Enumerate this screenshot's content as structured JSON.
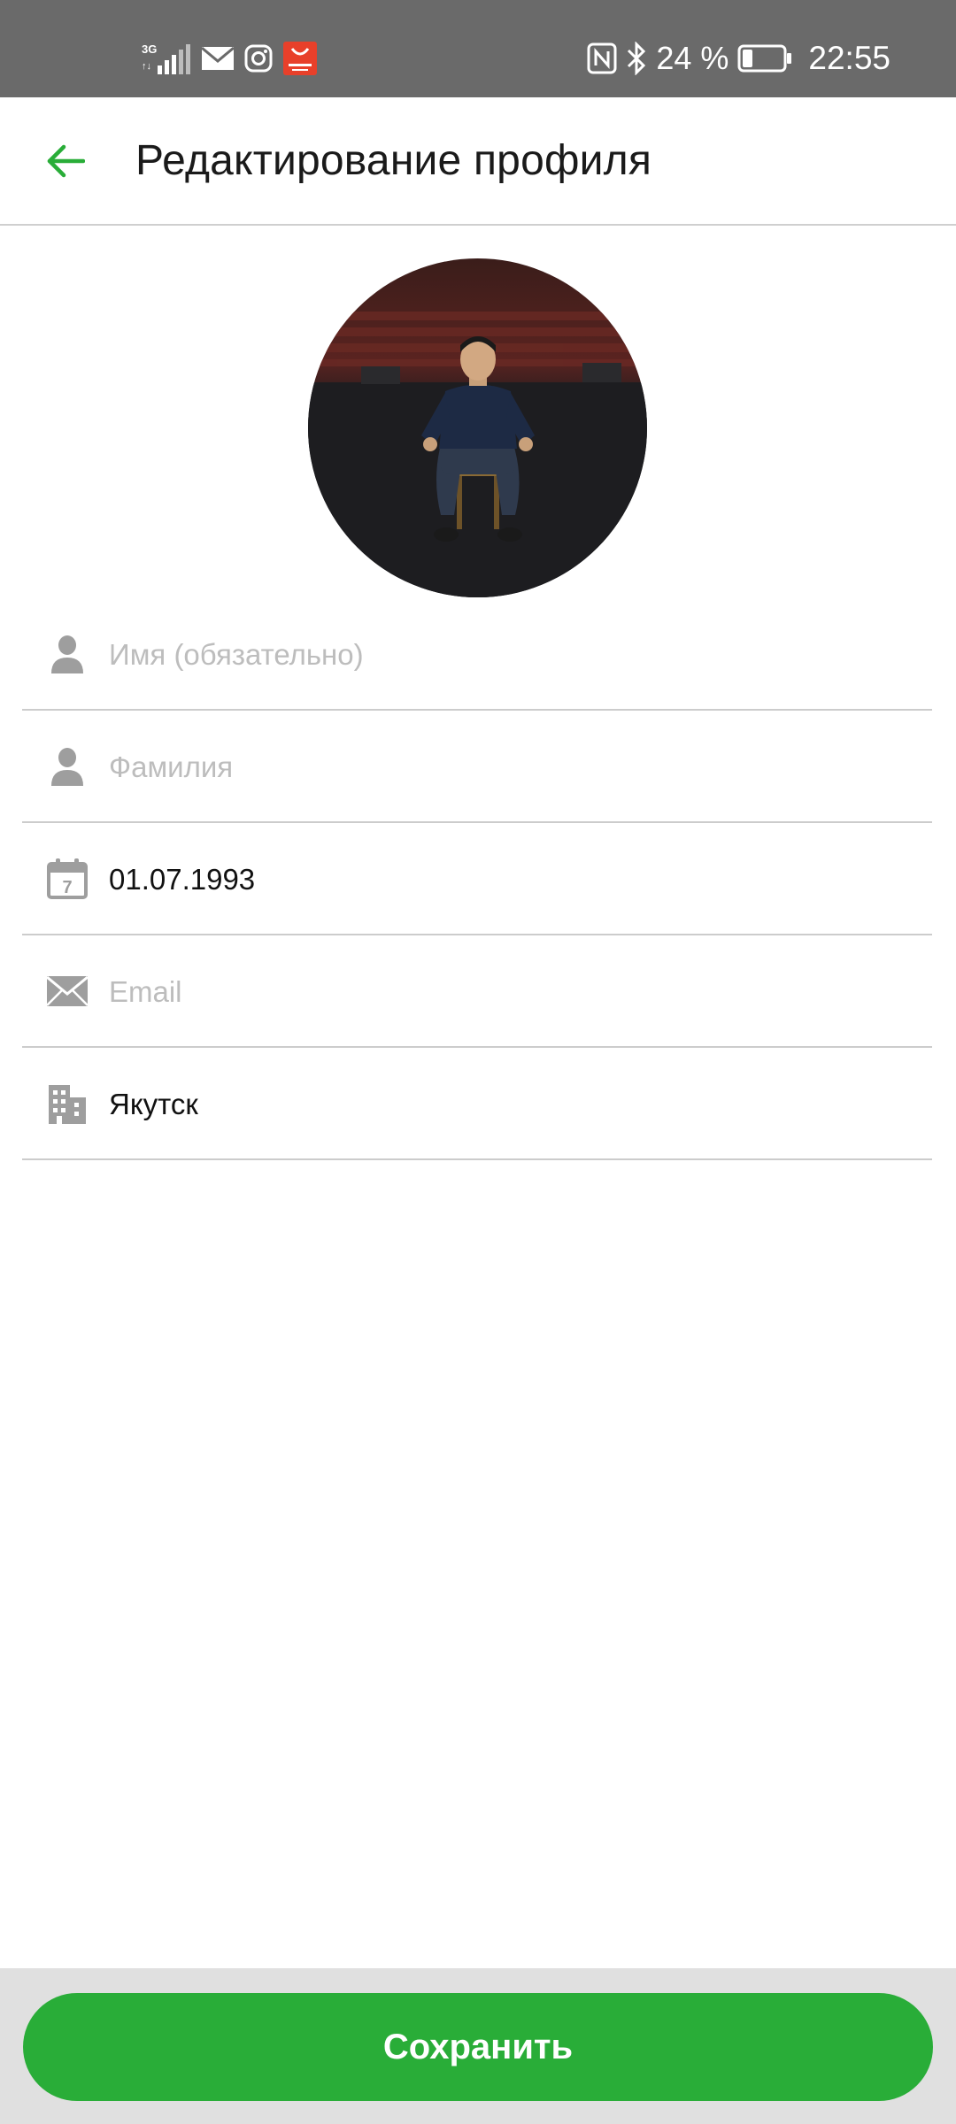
{
  "status_bar": {
    "network_label": "3G",
    "battery_percent": "24 %",
    "battery_level": 0.24,
    "time": "22:55",
    "icons": [
      "signal-icon",
      "mail-icon",
      "instagram-icon",
      "aliexpress-icon",
      "nfc-icon",
      "bluetooth-icon",
      "battery-icon"
    ]
  },
  "header": {
    "title": "Редактирование профиля",
    "back_icon": "arrow-left-icon"
  },
  "profile": {
    "avatar_icon": "profile-photo"
  },
  "form": {
    "first_name": {
      "placeholder": "Имя (обязательно)",
      "value": "",
      "icon": "person-icon"
    },
    "last_name": {
      "placeholder": "Фамилия",
      "value": "",
      "icon": "person-icon"
    },
    "birth_date": {
      "placeholder": "",
      "value": "01.07.1993",
      "icon": "calendar-icon",
      "calendar_day": "7"
    },
    "email": {
      "placeholder": "Email",
      "value": "",
      "icon": "envelope-icon"
    },
    "city": {
      "placeholder": "",
      "value": "Якутск",
      "icon": "building-icon"
    }
  },
  "footer": {
    "save_label": "Сохранить"
  },
  "colors": {
    "accent": "#29ad38",
    "status_bar": "#6a6a6a",
    "icon_gray": "#9e9e9e",
    "placeholder": "#bdbdbd",
    "divider": "#cccccc",
    "footer_bg": "#e0e0e0"
  }
}
